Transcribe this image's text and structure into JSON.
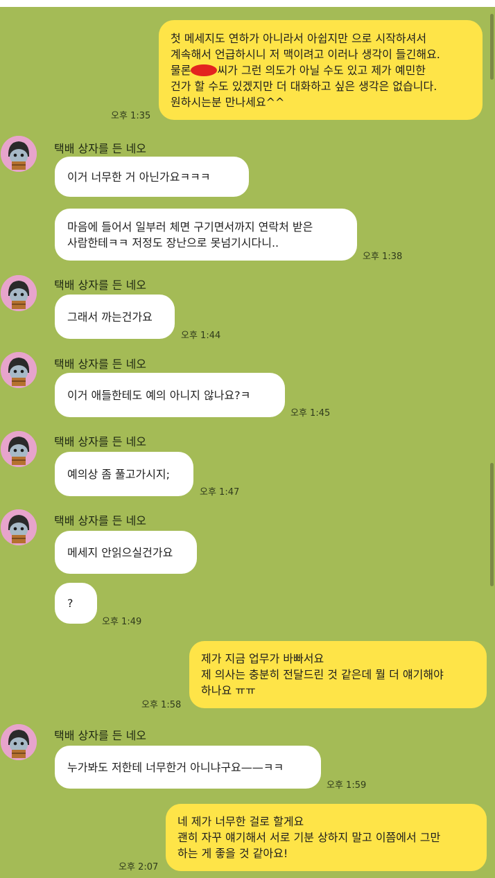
{
  "contact": {
    "name": "택배 상자를 든 네오",
    "avatar_icon": "neo-character-avatar-icon",
    "avatar_color": "#e7a4cc"
  },
  "colors": {
    "chat_background": "#a4bb56",
    "incoming_bubble": "#ffffff",
    "outgoing_bubble": "#fee448",
    "redaction_mark": "#e3231f"
  },
  "messages": {
    "m1": {
      "line1": "첫 메세지도 연하가 아니라서 아쉽지만 으로 시작하셔서",
      "line2": "계속해서 언급하시니 저 맥이려고 이러나 생각이 들긴해요.",
      "line3_before": "물론",
      "line3_after": "씨가 그런 의도가 아닐 수도 있고 제가 예민한",
      "line4": "건가 할 수도 있겠지만 더 대화하고 싶은 생각은 없습니다.",
      "line5": "원하시는분 만나세요^^",
      "time": "오후 1:35"
    },
    "m2": {
      "line1": "이거 너무한 거 아닌가요ㅋㅋㅋ"
    },
    "m3": {
      "line1": "마음에 들어서 일부러 체면 구기면서까지 연락처 받은",
      "line2": "사람한테ㅋㅋ 저정도 장난으로 못넘기시다니..",
      "time": "오후 1:38"
    },
    "m4": {
      "line1": "그래서 까는건가요",
      "time": "오후 1:44"
    },
    "m5": {
      "line1": "이거 애들한테도 예의 아니지 않나요?ㅋ",
      "time": "오후 1:45"
    },
    "m6": {
      "line1": "예의상 좀 풀고가시지;",
      "time": "오후 1:47"
    },
    "m7": {
      "line1": "메세지 안읽으실건가요"
    },
    "m8": {
      "line1": "?",
      "time": "오후 1:49"
    },
    "m9": {
      "line1": "제가 지금 업무가 바빠서요",
      "line2": "제 의사는 충분히 전달드린 것 같은데 뭘 더 얘기해야",
      "line3": "하나요 ㅠㅠ",
      "time": "오후 1:58"
    },
    "m10": {
      "line1": "누가봐도 저한테 너무한거 아니냐구요——ㅋㅋ",
      "time": "오후 1:59"
    },
    "m11": {
      "line1": "네 제가 너무한 걸로 할게요",
      "line2": "괜히 자꾸 얘기해서 서로 기분 상하지 말고 이쯤에서 그만",
      "line3": "하는 게 좋을 것 같아요!",
      "time": "오후 2:07"
    }
  }
}
